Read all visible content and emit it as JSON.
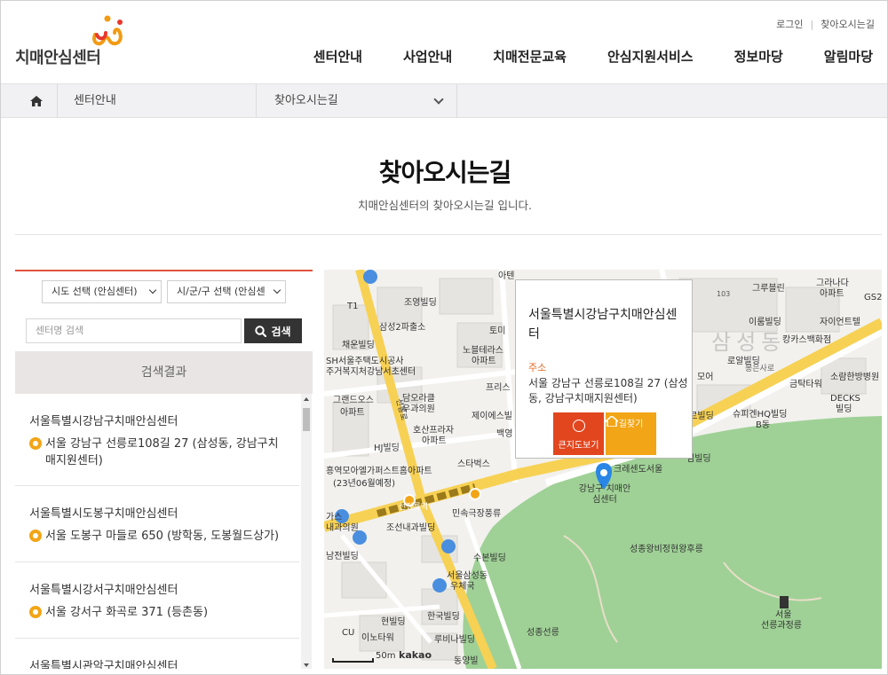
{
  "header": {
    "logo_text": "치매안심센터",
    "util": [
      "로그인",
      "찾아오시는길"
    ],
    "nav": [
      "센터안내",
      "사업안내",
      "치매전문교육",
      "안심지원서비스",
      "정보마당",
      "알림마당"
    ]
  },
  "breadcrumb": {
    "level1": "센터안내",
    "level2": "찾아오시는길"
  },
  "page": {
    "title": "찾아오시는길",
    "subtitle": "치매안심센터의 찾아오시는길 입니다."
  },
  "search": {
    "sido_select": "시도 선택 (안심센터)",
    "sigungu_select": "시/군/구 선택 (안심센",
    "placeholder": "센터명 검색",
    "button": "검색",
    "results_header": "검색결과"
  },
  "results": [
    {
      "name": "서울특별시강남구치매안심센터",
      "address": "서울 강남구 선릉로108길 27 (삼성동, 강남구치매지원센터)"
    },
    {
      "name": "서울특별시도봉구치매안심센터",
      "address": "서울 도봉구 마들로 650 (방학동, 도봉월드상가)"
    },
    {
      "name": "서울특별시강서구치매안심센터",
      "address": "서울 강서구 화곡로 371 (등촌동)"
    },
    {
      "name": "서울특별시관악구치매안심센터",
      "address": ""
    }
  ],
  "map": {
    "popup": {
      "title": "서울특별시강남구치매안심센터",
      "address_label": "주소",
      "address": "서울 강남구 선릉로108길 27 (삼성동, 강남구치매지원센터)",
      "btn_bigmap": "큰지도보기",
      "btn_route": "길찾기"
    },
    "marker_label": "강남구 치매안심센터",
    "scale_label": "50m",
    "brand": "kakao",
    "labels": [
      "T1",
      "조영빌딩",
      "삼성2파출소",
      "채운빌딩",
      "SH서울주택도시공사",
      "주거복지처강남서초센터",
      "그랜드오스",
      "아파트",
      "HJ빌딩",
      "담오라클",
      "우과의원",
      "호산프라자",
      "아파트",
      "노블테라스",
      "아파트",
      "토미",
      "프리스",
      "제이에스빌",
      "백영",
      "스타벅스",
      "크레센도서울",
      "민속극장풍류",
      "조선내과빌딩",
      "수본빌딩",
      "서울삼성동",
      "우체국",
      "한국빌딩",
      "현빌딩",
      "루비나빌딩",
      "이노타워",
      "CU",
      "동양빌",
      "남전빌딩",
      "성종선릉",
      "성종왕비정현왕후릉",
      "서울",
      "선릉과정릉",
      "그루블린",
      "그라나다",
      "아파트",
      "GS2",
      "이룸빌딩",
      "자이언트텔",
      "캉카스백화점",
      "로알빌딩",
      "소람한방병원",
      "금탁타워",
      "DECKS",
      "빌딩",
      "슈피겐HQ빌딩",
      "B동",
      "베르빌딩",
      "심빌딩",
      "모어",
      "103",
      "선정릉역",
      "선릉로",
      "삼성동",
      "봉은사로",
      "아텐",
      "흥역모아엘가퍼스트홈아파트",
      "(23년06월예정)",
      "가스",
      "내과의원"
    ]
  },
  "colors": {
    "accent": "#e2533c",
    "orange": "#e56a24",
    "yellow": "#f2a516",
    "park": "#9fd196",
    "road": "#f7d154"
  }
}
